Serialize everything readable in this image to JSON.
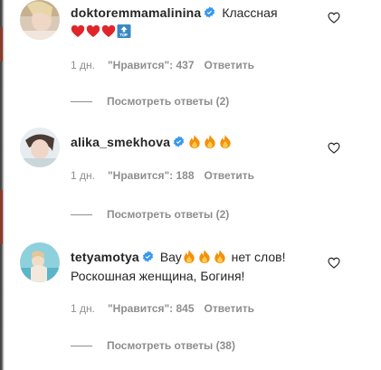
{
  "comments": [
    {
      "username": "doktoremmamalinina",
      "text": "Классная",
      "emojis": [
        "red-heart",
        "red-heart",
        "red-heart",
        "top-arrow"
      ],
      "time": "1 дн.",
      "likes": "\"Нравится\": 437",
      "reply_label": "Ответить",
      "view_replies": "Посмотреть ответы (2)"
    },
    {
      "username": "alika_smekhova",
      "text": "",
      "emojis": [
        "fire",
        "fire",
        "fire"
      ],
      "time": "1 дн.",
      "likes": "\"Нравится\": 188",
      "reply_label": "Ответить",
      "view_replies": "Посмотреть ответы (2)"
    },
    {
      "username": "tetyamotya",
      "text_before": "Вау",
      "emojis": [
        "fire",
        "fire",
        "fire"
      ],
      "text_after": " нет слов!",
      "text_line2": "Роскошная женщина, Богиня!",
      "time": "1 дн.",
      "likes": "\"Нравится\": 845",
      "reply_label": "Ответить",
      "view_replies": "Посмотреть ответы (38)"
    }
  ],
  "colors": {
    "text": "#262626",
    "secondary": "#8e8e8e",
    "verified": "#3897f0",
    "heart_emoji": "#e0262b",
    "fire_emoji": "#f4900c"
  }
}
